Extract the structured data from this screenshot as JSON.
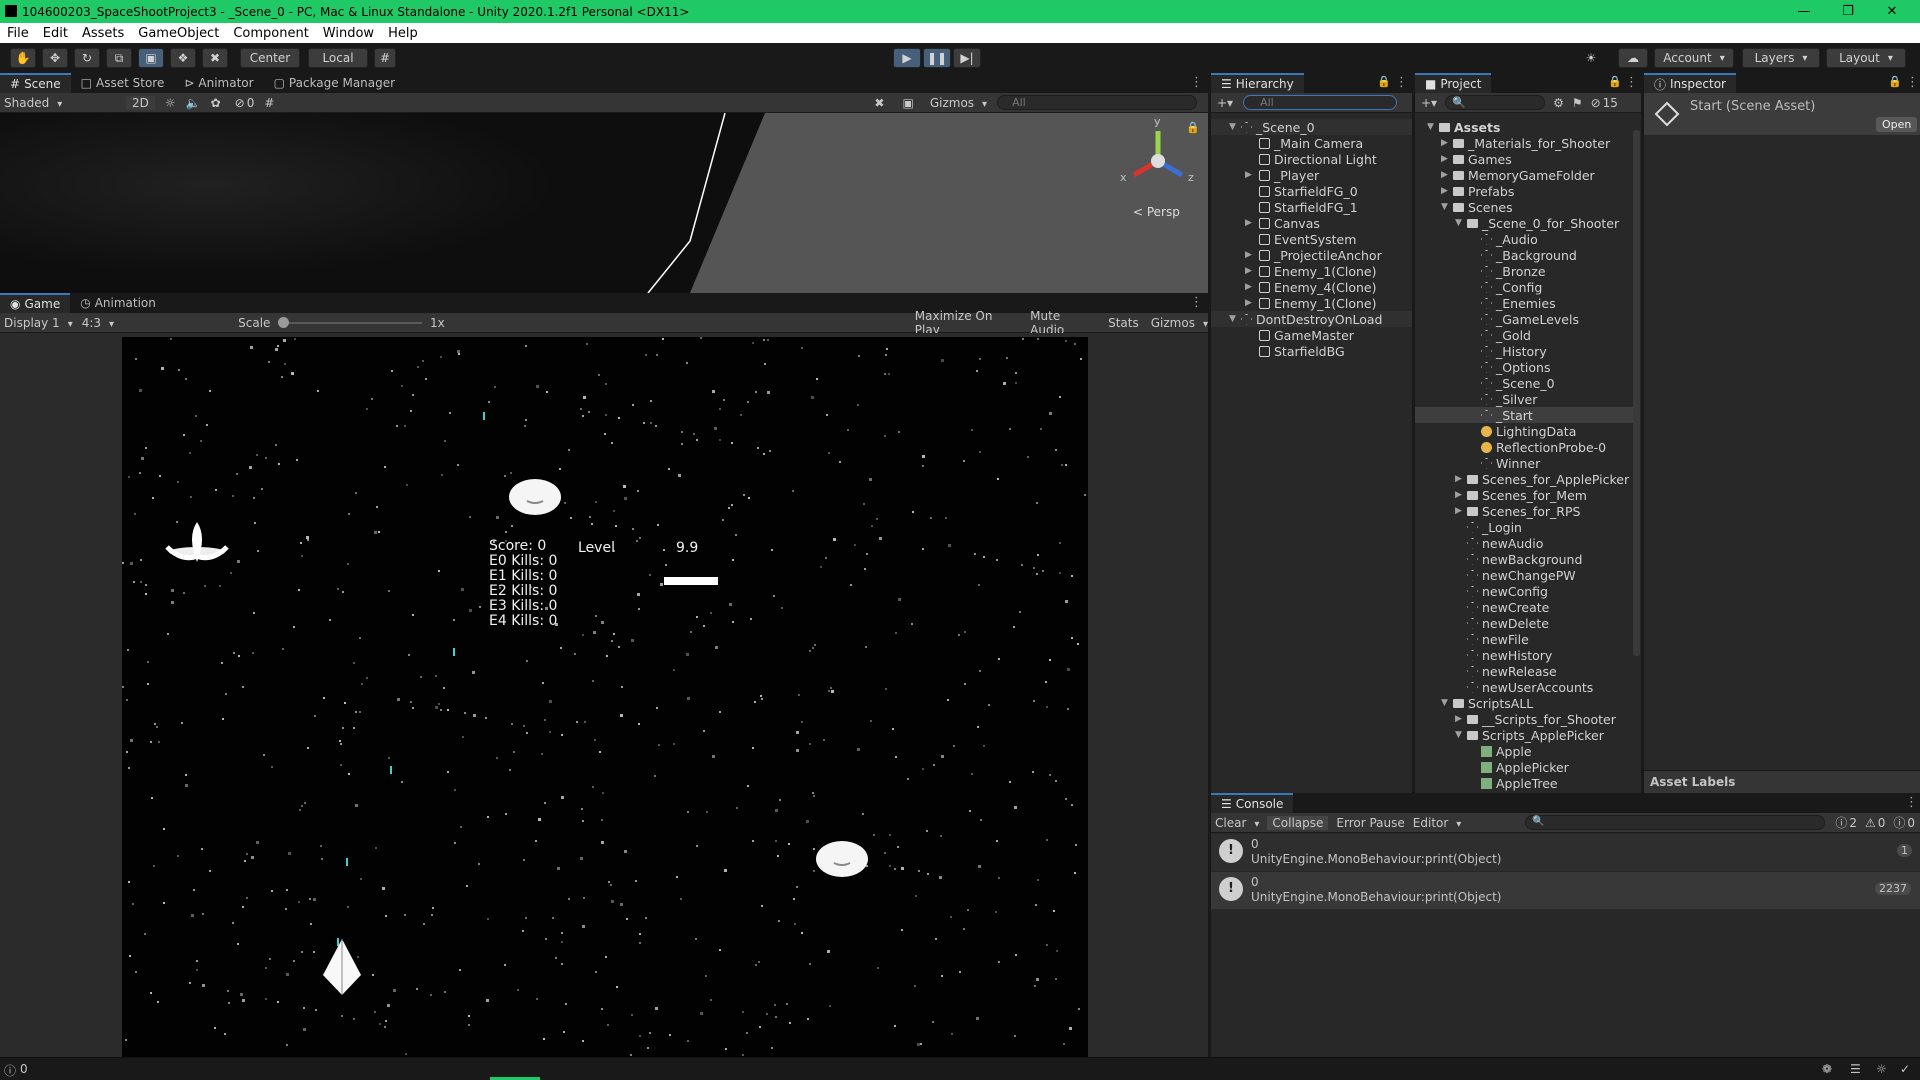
{
  "window": {
    "title": "104600203_SpaceShootProject3 - _Scene_0 - PC, Mac & Linux Standalone - Unity 2020.1.2f1 Personal <DX11>"
  },
  "menu": [
    "File",
    "Edit",
    "Assets",
    "GameObject",
    "Component",
    "Window",
    "Help"
  ],
  "toolbar": {
    "center": "Center",
    "local": "Local",
    "account": "Account",
    "layers": "Layers",
    "layout": "Layout"
  },
  "scene_tabs": [
    "Scene",
    "Asset Store",
    "Animator",
    "Package Manager"
  ],
  "scene_bar": {
    "shading": "Shaded",
    "mode2d": "2D",
    "hidden_count": "0",
    "gizmos": "Gizmos",
    "search_placeholder": "All",
    "persp": "< Persp",
    "axis_x": "x",
    "axis_y": "y",
    "axis_z": "z"
  },
  "game_tabs": [
    "Game",
    "Animation"
  ],
  "game_bar": {
    "display": "Display 1",
    "aspect": "4:3",
    "scale_label": "Scale",
    "scale_value": "1x",
    "maximize": "Maximize On Play",
    "mute": "Mute Audio",
    "stats": "Stats",
    "gizmos": "Gizmos",
    "scale_fraction": 0
  },
  "hud": {
    "score": "Score: 0",
    "e0": "E0 Kills: 0",
    "e1": "E1 Kills: 0",
    "e2": "E2 Kills: 0",
    "e3": "E3 Kills: 0",
    "e4": "E4 Kills: 0",
    "level_label": "Level",
    "level_value": "9.9"
  },
  "hierarchy": {
    "title": "Hierarchy",
    "search_placeholder": "All",
    "items": [
      "_Scene_0",
      "_Main Camera",
      "Directional Light",
      "_Player",
      "StarfieldFG_0",
      "StarfieldFG_1",
      "Canvas",
      "EventSystem",
      "_ProjectileAnchor",
      "Enemy_1(Clone)",
      "Enemy_4(Clone)",
      "Enemy_1(Clone)",
      "DontDestroyOnLoad",
      "GameMaster",
      "StarfieldBG"
    ]
  },
  "project": {
    "title": "Project",
    "hidden_count": "15",
    "items": [
      "Assets",
      "_Materials_for_Shooter",
      "Games",
      "MemoryGameFolder",
      "Prefabs",
      "Scenes",
      "_Scene_0_for_Shooter",
      "_Audio",
      "_Background",
      "_Bronze",
      "_Config",
      "_Enemies",
      "_GameLevels",
      "_Gold",
      "_History",
      "_Options",
      "_Scene_0",
      "_Silver",
      "_Start",
      "LightingData",
      "ReflectionProbe-0",
      "Winner",
      "Scenes_for_ApplePicker",
      "Scenes_for_Mem",
      "Scenes_for_RPS",
      "_Login",
      "newAudio",
      "newBackground",
      "newChangePW",
      "newConfig",
      "newCreate",
      "newDelete",
      "newFile",
      "newHistory",
      "newRelease",
      "newUserAccounts",
      "ScriptsALL",
      "__Scripts_for_Shooter",
      "Scripts_ApplePicker",
      "Apple",
      "ApplePicker",
      "AppleTree"
    ]
  },
  "inspector": {
    "title": "Inspector",
    "heading": "Start (Scene Asset)",
    "open": "Open",
    "labels": "Asset Labels"
  },
  "console": {
    "title": "Console",
    "clear": "Clear",
    "collapse": "Collapse",
    "error_pause": "Error Pause",
    "editor": "Editor",
    "count_info": "2",
    "count_warn": "0",
    "count_err": "0",
    "logs": [
      {
        "line1": "0",
        "line2": "UnityEngine.MonoBehaviour:print(Object)",
        "count": "1"
      },
      {
        "line1": "0",
        "line2": "UnityEngine.MonoBehaviour:print(Object)",
        "count": "2237"
      }
    ]
  },
  "statusbar": {
    "count": "0"
  }
}
